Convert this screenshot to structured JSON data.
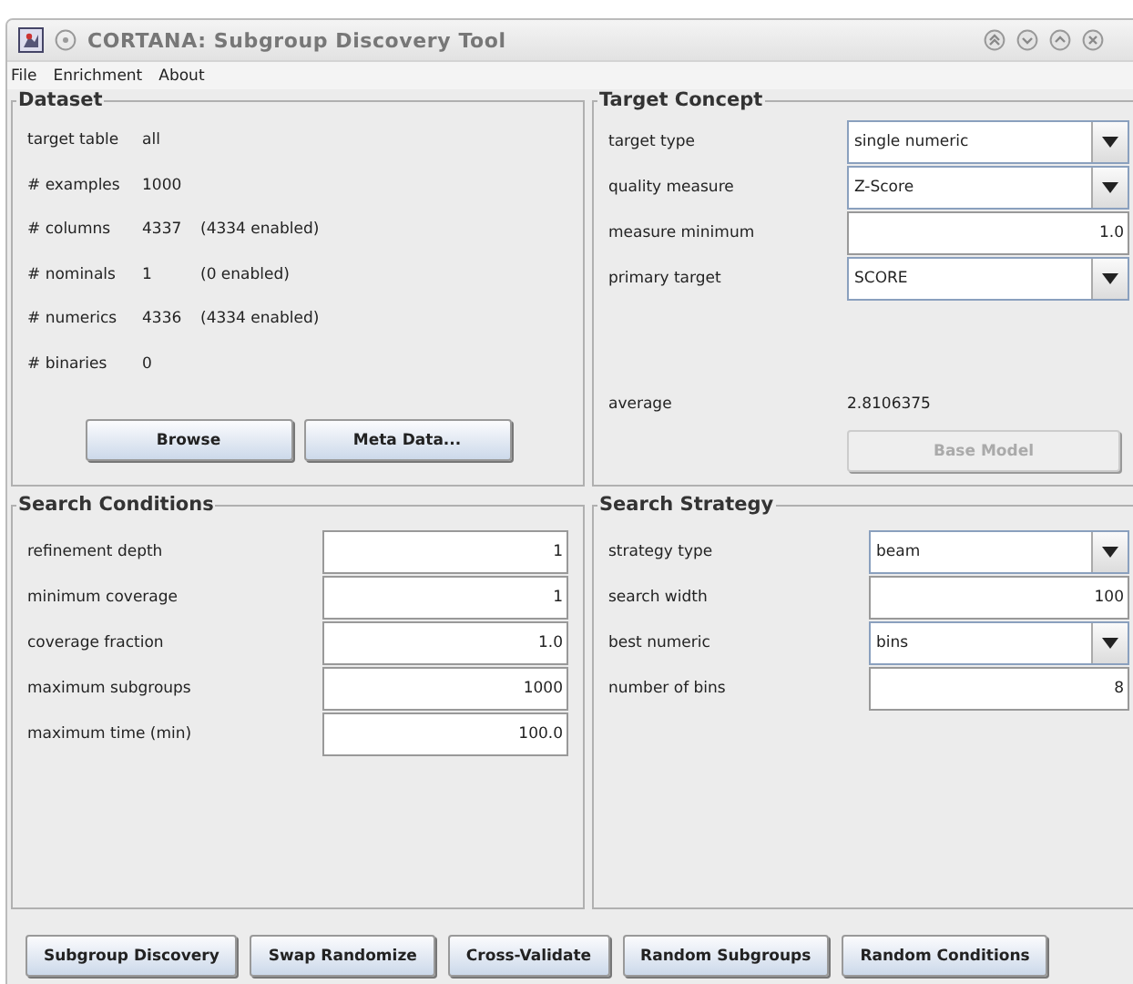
{
  "window": {
    "title": "CORTANA: Subgroup Discovery Tool"
  },
  "menu": [
    "File",
    "Enrichment",
    "About"
  ],
  "dataset": {
    "title": "Dataset",
    "rows": [
      {
        "label": "target table",
        "value": "all"
      },
      {
        "label": "# examples",
        "value": "1000"
      },
      {
        "label": "# columns",
        "value": "4337",
        "note": "(4334 enabled)"
      },
      {
        "label": "# nominals",
        "value": "1",
        "note": "(0 enabled)"
      },
      {
        "label": "# numerics",
        "value": "4336",
        "note": "(4334 enabled)"
      },
      {
        "label": "# binaries",
        "value": "0"
      }
    ],
    "buttons": [
      {
        "label": "Browse",
        "disabled": false
      },
      {
        "label": "Meta Data...",
        "disabled": false
      }
    ]
  },
  "target_concept": {
    "title": "Target Concept",
    "rows": [
      {
        "kind": "dropdown",
        "label": "target type",
        "value": "single numeric"
      },
      {
        "kind": "dropdown",
        "label": "quality measure",
        "value": "Z-Score"
      },
      {
        "kind": "field",
        "label": "measure minimum",
        "value": "1.0"
      },
      {
        "kind": "dropdown",
        "label": "primary target",
        "value": "SCORE"
      }
    ],
    "average": {
      "label": "average",
      "value": "2.8106375"
    },
    "button": {
      "label": "Base Model",
      "disabled": true
    }
  },
  "search_conditions": {
    "title": "Search Conditions",
    "rows": [
      {
        "kind": "field",
        "label": "refinement depth",
        "value": "1"
      },
      {
        "kind": "field",
        "label": "minimum coverage",
        "value": "1"
      },
      {
        "kind": "field",
        "label": "coverage fraction",
        "value": "1.0"
      },
      {
        "kind": "field",
        "label": "maximum subgroups",
        "value": "1000"
      },
      {
        "kind": "field",
        "label": "maximum time (min)",
        "value": "100.0"
      }
    ]
  },
  "search_strategy": {
    "title": "Search Strategy",
    "rows": [
      {
        "kind": "dropdown",
        "label": "strategy type",
        "value": "beam"
      },
      {
        "kind": "field",
        "label": "search width",
        "value": "100"
      },
      {
        "kind": "dropdown",
        "label": "best numeric",
        "value": "bins"
      },
      {
        "kind": "field",
        "label": "number of bins",
        "value": "8"
      }
    ]
  },
  "buttons": [
    {
      "label": "Subgroup Discovery",
      "disabled": false
    },
    {
      "label": "Swap Randomize",
      "disabled": false
    },
    {
      "label": "Cross-Validate",
      "disabled": false
    },
    {
      "label": "Random Subgroups",
      "disabled": false
    },
    {
      "label": "Random Conditions",
      "disabled": false
    }
  ]
}
